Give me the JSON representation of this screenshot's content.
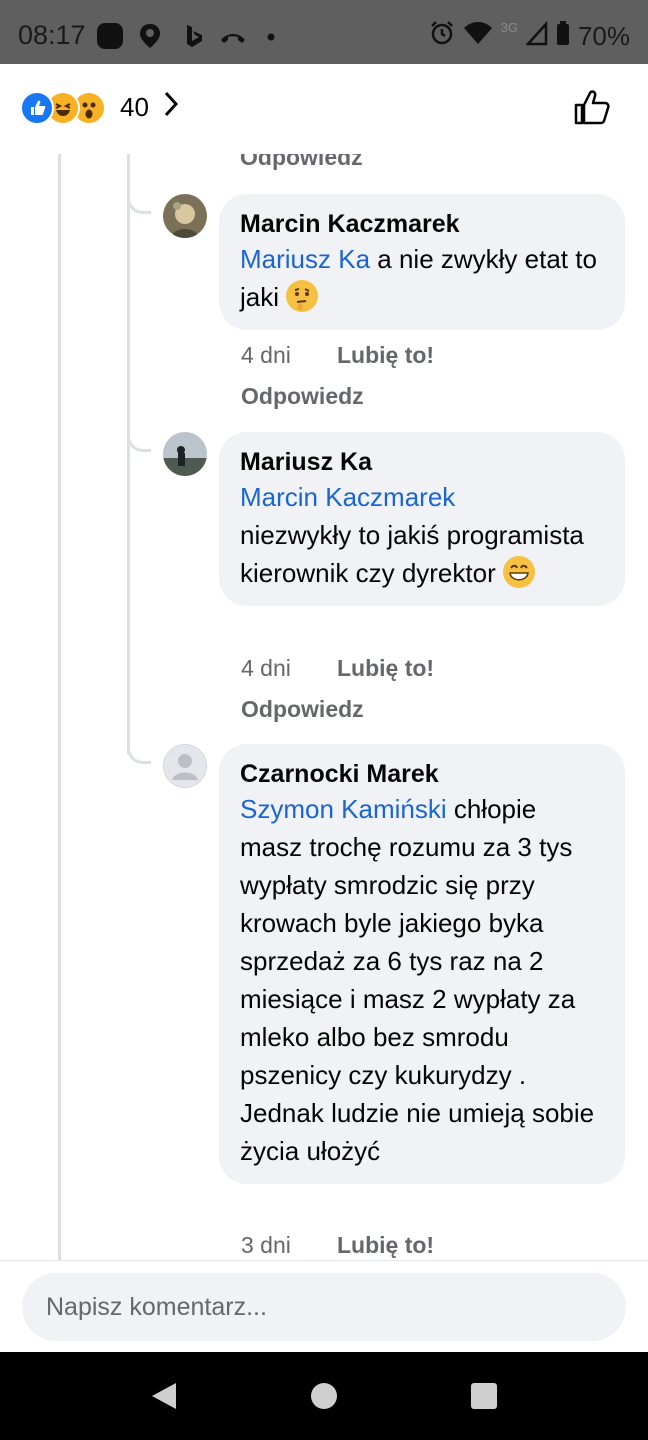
{
  "status_bar": {
    "time": "08:17",
    "network": "3G",
    "battery": "70%",
    "icons": [
      "app-icon",
      "location-icon",
      "bing-icon",
      "missed-call-icon",
      "dot-icon",
      "alarm-icon",
      "wifi-icon",
      "signal-icon",
      "battery-icon"
    ]
  },
  "header": {
    "reaction_icons": [
      "like-reaction-icon",
      "haha-reaction-icon",
      "wow-reaction-icon"
    ],
    "reaction_count": "40",
    "chevron": "chevron-right-icon",
    "like_button_icon": "thumbs-up-icon"
  },
  "thread": {
    "partial_action_label": "Odpowiedz",
    "comments": [
      {
        "author": "Marcin Kaczmarek",
        "mention": "Mariusz Ka",
        "text": " a nie zwykły etat to jaki",
        "emoji": "thinking-face-emoji",
        "age": "4 dni",
        "like_label": "Lubię to!",
        "reply_label": "Odpowiedz"
      },
      {
        "author": "Mariusz Ka",
        "mention": "Marcin Kaczmarek",
        "text": "niezwykły to jakiś programista kierownik czy dyrektor",
        "emoji": "grinning-face-emoji",
        "age": "4 dni",
        "like_label": "Lubię to!",
        "reply_label": "Odpowiedz"
      },
      {
        "author": "Czarnocki Marek",
        "mention": "Szymon Kamiński",
        "text": " chłopie masz trochę rozumu za 3 tys wypłaty smrodzic się przy krowach byle jakiego byka sprzedaż za 6 tys raz na 2 miesiące i masz 2 wypłaty za mleko albo bez smrodu pszenicy czy kukurydzy . Jednak ludzie nie umieją sobie życia ułożyć",
        "age": "3 dni",
        "like_label": "Lubię to!"
      }
    ]
  },
  "composer": {
    "placeholder": "Napisz komentarz..."
  },
  "nav": {
    "buttons": [
      "back-icon",
      "home-icon",
      "recents-icon"
    ]
  },
  "colors": {
    "mention": "#1a65d6",
    "bubble": "#f0f2f5",
    "secondary_text": "#65676b",
    "like_blue": "#1877f2",
    "status_bar": "#5f5f5f"
  }
}
